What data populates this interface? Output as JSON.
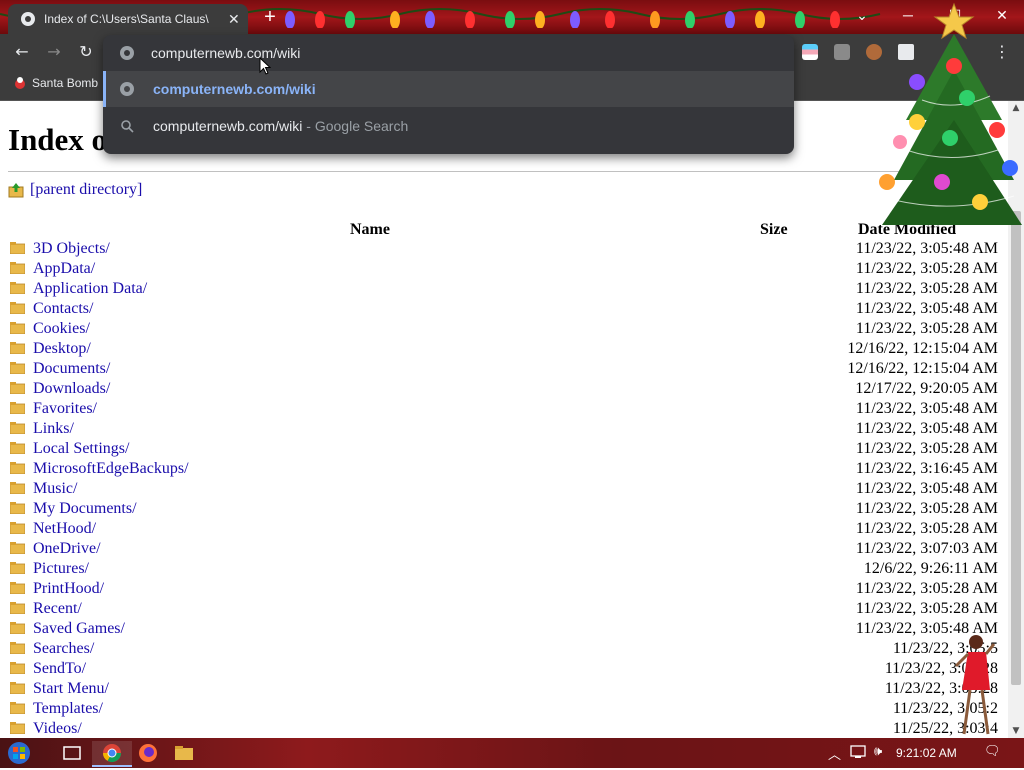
{
  "browser": {
    "tab_title": "Index of C:\\Users\\Santa Claus\\",
    "tab_close": "✕",
    "new_tab": "+",
    "win_menu": "⌄",
    "win_min": "─",
    "win_max": "☐",
    "win_close": "✕",
    "nav_back": "←",
    "nav_forward": "→",
    "nav_reload": "↻",
    "menu": "⋮",
    "bookmark_label": "Santa Bomb"
  },
  "omnibox": {
    "value": "computernewb.com/wiki",
    "suggestions": [
      {
        "text": "computernewb.com/wiki",
        "suffix": "",
        "icon": "globe-icon"
      },
      {
        "text": "computernewb.com/wiki",
        "suffix": " - Google Search",
        "icon": "search-icon"
      }
    ]
  },
  "page": {
    "heading": "Index of C:\\Users\\Santa Claus\\",
    "parent_link": "[parent directory]",
    "columns": {
      "name": "Name",
      "size": "Size",
      "date": "Date Modified"
    },
    "rows": [
      {
        "name": "3D Objects/",
        "date": "11/23/22, 3:05:48 AM"
      },
      {
        "name": "AppData/",
        "date": "11/23/22, 3:05:28 AM"
      },
      {
        "name": "Application Data/",
        "date": "11/23/22, 3:05:28 AM"
      },
      {
        "name": "Contacts/",
        "date": "11/23/22, 3:05:48 AM"
      },
      {
        "name": "Cookies/",
        "date": "11/23/22, 3:05:28 AM"
      },
      {
        "name": "Desktop/",
        "date": "12/16/22, 12:15:04 AM"
      },
      {
        "name": "Documents/",
        "date": "12/16/22, 12:15:04 AM"
      },
      {
        "name": "Downloads/",
        "date": "12/17/22, 9:20:05 AM"
      },
      {
        "name": "Favorites/",
        "date": "11/23/22, 3:05:48 AM"
      },
      {
        "name": "Links/",
        "date": "11/23/22, 3:05:48 AM"
      },
      {
        "name": "Local Settings/",
        "date": "11/23/22, 3:05:28 AM"
      },
      {
        "name": "MicrosoftEdgeBackups/",
        "date": "11/23/22, 3:16:45 AM"
      },
      {
        "name": "Music/",
        "date": "11/23/22, 3:05:48 AM"
      },
      {
        "name": "My Documents/",
        "date": "11/23/22, 3:05:28 AM"
      },
      {
        "name": "NetHood/",
        "date": "11/23/22, 3:05:28 AM"
      },
      {
        "name": "OneDrive/",
        "date": "11/23/22, 3:07:03 AM"
      },
      {
        "name": "Pictures/",
        "date": "12/6/22, 9:26:11 AM"
      },
      {
        "name": "PrintHood/",
        "date": "11/23/22, 3:05:28 AM"
      },
      {
        "name": "Recent/",
        "date": "11/23/22, 3:05:28 AM"
      },
      {
        "name": "Saved Games/",
        "date": "11/23/22, 3:05:48 AM"
      },
      {
        "name": "Searches/",
        "date": "11/23/22, 3:05:5"
      },
      {
        "name": "SendTo/",
        "date": "11/23/22, 3:05:28"
      },
      {
        "name": "Start Menu/",
        "date": "11/23/22, 3:05:28"
      },
      {
        "name": "Templates/",
        "date": "11/23/22, 3:05:2"
      },
      {
        "name": "Videos/",
        "date": "11/25/22, 3:03:4"
      }
    ]
  },
  "taskbar": {
    "clock": "9:21:02 AM",
    "tray_chevron": "︿",
    "tray_volume": "🕪",
    "tray_notify": "🗨"
  },
  "colors": {
    "link": "#1a0dab",
    "omnibox_link": "#8ab4f8",
    "chrome_dark": "#3c3c3c",
    "folder": "#e8b84a"
  }
}
